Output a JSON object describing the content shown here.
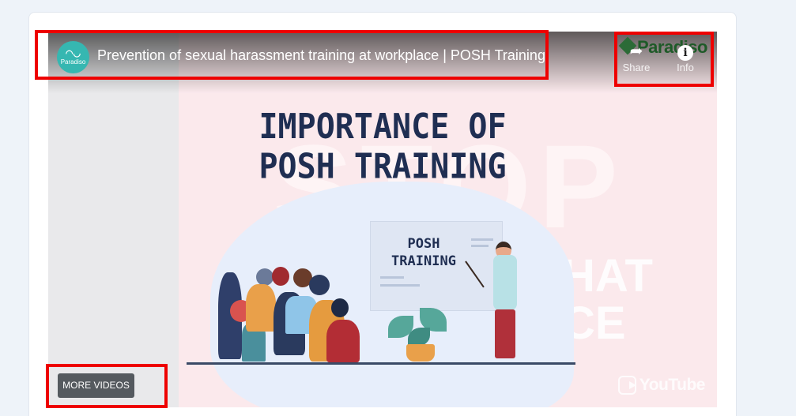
{
  "video": {
    "title": "Prevention of sexual harassment training at workplace | POSH Training",
    "channel_avatar_text": "Paradiso",
    "brand_logo_text": "Paradiso",
    "share_label": "Share",
    "info_label": "Info",
    "more_videos_label": "MORE VIDEOS",
    "platform_logo_text": "YouTube"
  },
  "thumbnail": {
    "headline": "IMPORTANCE OF POSH TRAINING",
    "board_text": "POSH TRAINING",
    "background_word": "STOP",
    "background_text": "HAT CE"
  },
  "colors": {
    "highlight": "#ee0000",
    "channel_avatar": "#36b7b1",
    "more_videos_bg": "#555a5f",
    "headline": "#1f2e52"
  },
  "icons": {
    "share": "share-arrow-icon",
    "info": "info-circle-icon",
    "play": "youtube-play-icon"
  }
}
